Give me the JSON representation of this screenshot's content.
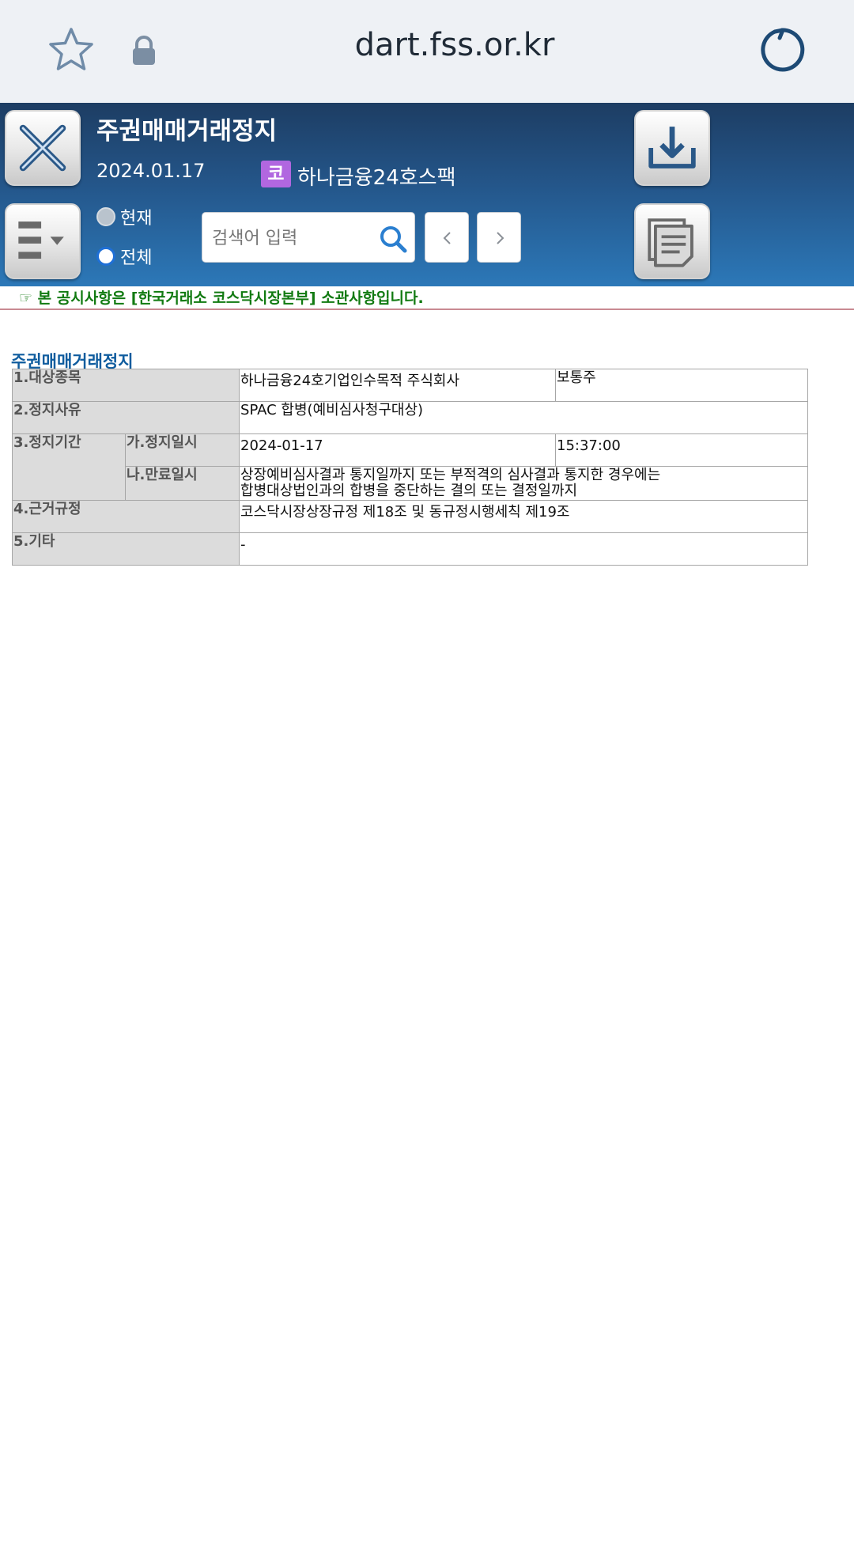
{
  "browser": {
    "url": "dart.fss.or.kr",
    "icons": [
      "star-icon",
      "lock-icon",
      "reload-icon"
    ]
  },
  "toolbar": {
    "title": "주권매매거래정지",
    "date": "2024.01.17",
    "market_badge": "코",
    "market_badge_color": "#b167e0",
    "company": "하나금융24호스팩",
    "radio_current": "현재",
    "radio_all": "전체",
    "selected_radio": "전체",
    "search_placeholder": "검색어 입력",
    "icons": [
      "close-icon",
      "menu-icon",
      "download-icon",
      "copy-document-icon",
      "search-icon",
      "chevron-left-icon",
      "chevron-right-icon"
    ]
  },
  "notice": {
    "text": "☞ 본 공시사항은 [한국거래소 코스닥시장본부] 소관사항입니다.",
    "color": "#117a11"
  },
  "document": {
    "heading": "주권매매거래정지",
    "rows": {
      "item1_label": "1.대상종목",
      "item1_value": "하나금융24호기업인수목적 주식회사",
      "item1_type": "보통주",
      "item2_label": "2.정지사유",
      "item2_value": "SPAC 합병(예비심사청구대상)",
      "item3_label": "3.정지기간",
      "item3a_label": "가.정지일시",
      "item3a_date": "2024-01-17",
      "item3a_time": "15:37:00",
      "item3b_label": "나.만료일시",
      "item3b_line1": "상장예비심사결과 통지일까지 또는 부적격의 심사결과 통지한 경우에는",
      "item3b_line2": "합병대상법인과의 합병을 중단하는 결의 또는 결정일까지",
      "item4_label": "4.근거규정",
      "item4_value": "코스닥시장상장규정 제18조 및 동규정시행세칙 제19조",
      "item5_label": "5.기타",
      "item5_value": "-"
    }
  }
}
